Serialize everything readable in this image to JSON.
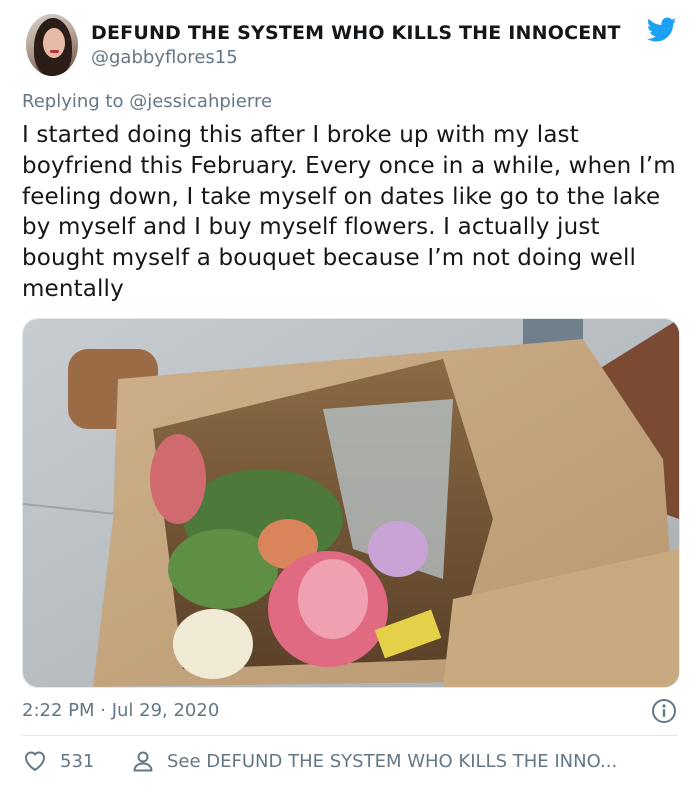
{
  "author": {
    "display_name": "DEFUND THE SYSTEM WHO KILLS THE INNOCENT",
    "handle": "@gabbyflores15"
  },
  "reply": {
    "prefix": "Replying to ",
    "to_handle": "@jessicahpierre"
  },
  "tweet": {
    "text": "I started doing this after I broke up with my last boyfriend this February. Every once in a while, when I’m feeling down, I take myself on dates like go to the lake by myself and I buy myself flowers. I actually just bought myself a bouquet because I’m not doing well mentally",
    "timestamp": "2:22 PM · Jul 29, 2020"
  },
  "stats": {
    "likes": "531",
    "see_more_label": "See DEFUND THE SYSTEM WHO KILLS THE INNO..."
  },
  "icons": {
    "brand": "twitter-bird-icon",
    "info": "info-icon",
    "like": "heart-icon",
    "profile": "person-icon"
  },
  "colors": {
    "twitter_blue": "#1da1f2",
    "secondary_text": "#657786",
    "primary_text": "#14171a",
    "divider": "#e1e8ed"
  }
}
